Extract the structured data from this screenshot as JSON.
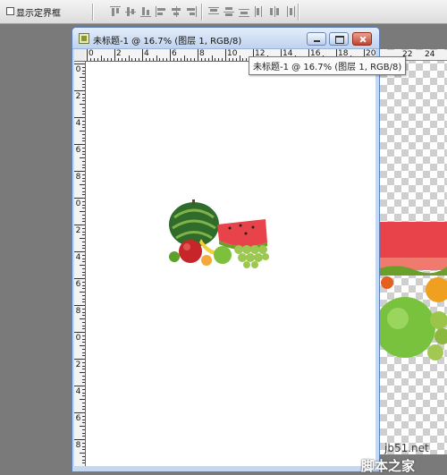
{
  "options_bar": {
    "show_bounds_label": "显示定界框",
    "show_bounds_checked": false
  },
  "document": {
    "title": "未标题-1 @ 16.7% (图层 1, RGB/8)",
    "tooltip": "未标题-1 @ 16.7% (图层 1, RGB/8)",
    "zoom": "16.7%",
    "layer": "图层 1",
    "mode": "RGB/8",
    "h_ruler_labels": [
      "0",
      "2",
      "4",
      "6",
      "8",
      "10",
      "12",
      "14",
      "16",
      "18",
      "20"
    ],
    "v_ruler_labels": [
      "0",
      "2",
      "4",
      "6",
      "8",
      "0",
      "2",
      "4",
      "6",
      "8",
      "0",
      "2",
      "4",
      "6",
      "8"
    ]
  },
  "background_document": {
    "h_ruler_labels": [
      "22",
      "24"
    ]
  },
  "watermark": {
    "site": "jb51.net",
    "brand": "脚本之家"
  },
  "icons": {
    "document_icon": "photoshop-doc-icon",
    "minimize": "minimize-icon",
    "maximize": "maximize-icon",
    "close": "close-icon",
    "checkbox": "checkbox-icon"
  },
  "colors": {
    "title_bar": "#c5d8f1",
    "close_button": "#c2432c",
    "app_background": "#7a7a7a"
  }
}
